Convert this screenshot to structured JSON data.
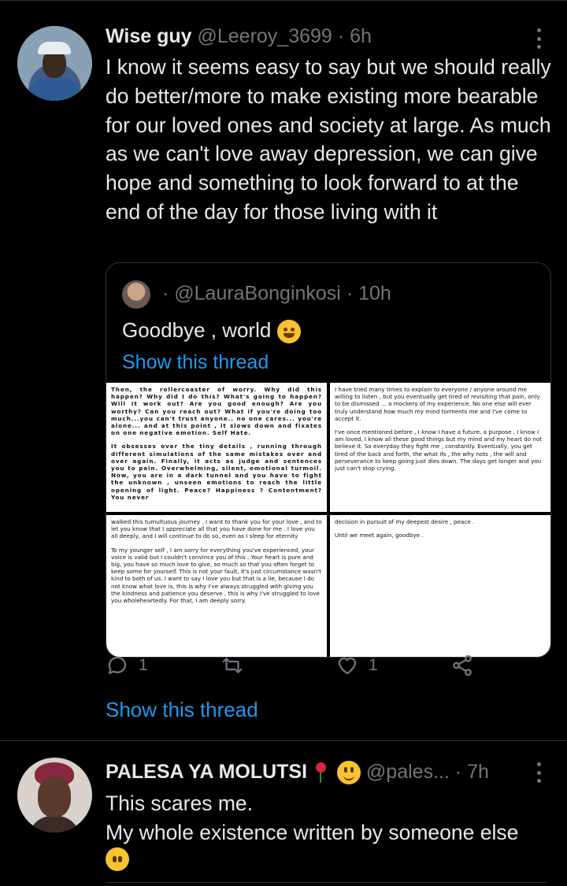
{
  "tweet1": {
    "display_name": "Wise guy",
    "handle": "@Leeroy_3699",
    "separator": "·",
    "time": "6h",
    "text": "I know it seems easy to say but we should really do better/more to make existing more bearable for our loved ones and society at large. As much as we can't love away depression, we can give hope and something to look forward to at the end of the day for those living with it",
    "quoted": {
      "dot": "·",
      "handle": "@LauraBonginkosi",
      "separator": "·",
      "time": "10h",
      "text": "Goodbye , world",
      "emoji": "hugging-face-emoji",
      "show_thread": "Show this thread",
      "images": {
        "img1": [
          "Then, the rollercoaster of worry. Why did this happen? Why did I do this? What's going to happen? Will it work out? Are you good enough? Are you worthy? Can you reach out? What if you're doing too much...you can't trust anyone.. no one cares... you're alone... and at this point , it slows down and fixates on one negative emotion. Self Hate.",
          "It obsesses over the tiny details , running through different simulations of the same mistakes over and over again. Finally, it acts as judge and sentences you to pain. Overwhelming, silent, emotional turmoil. Now, you are in a dark tunnel and you have to fight the unknown , unseen emotions to reach the little opening of light. Peace? Happiness ? Contentment? You never"
        ],
        "img2": [
          "I have tried many times to explain to everyone / anyone around me willing to listen , but you eventually get tired of revisiting that pain, only to be dismissed ... a mockery of my experience. No one else will ever truly understand how much my mind torments me and I've come to accept it.",
          "I've once mentioned before , I know I have a future, a purpose , I know I am loved, I know all these good things but my mind and my heart do not believe it. So everyday they fight me , constantly. Eventually, you get tired of the back and forth, the what ifs , the why nots , the will and perseverance to keep going just dies down. The days get longer and you just can't stop crying."
        ],
        "img3": [
          "walked this tumultuous journey . I want to thank you for your love , and to let you know that I appreciate all that you have done for me . I love you all deeply, and I will continue to do so, even as I sleep for eternity",
          "To my younger self , I am sorry for everything you've experienced, your voice is valid but I couldn't convince you of this . Your heart is pure and big, you have so much love to give, so much so that you often forget to keep some for yourself. This is not your fault, it's just circumstance wasn't kind to both of us. I want to say I love you but that is a lie, because I do not know what love is, this is why I've always struggled with giving you the kindness and patience you deserve , this is why I've struggled to love you wholeheartedly. For that, I am deeply sorry."
        ],
        "img4": [
          "decision in pursuit of my deepest desire , peace .",
          "Until we meet again, goodbye ."
        ]
      }
    },
    "actions": {
      "reply_count": "1",
      "retweet_count": "",
      "like_count": "1"
    },
    "show_thread": "Show this thread"
  },
  "tweet2": {
    "display_name": "PALESA YA MOLUTSI",
    "handle": "@pales...",
    "separator": "·",
    "time": "7h",
    "line1": "This scares me.",
    "line2": "My whole existence written by someone else",
    "emoji": "face-without-mouth-emoji"
  },
  "colors": {
    "background": "#000000",
    "text": "#e7e9ea",
    "secondary": "#71767b",
    "link": "#1d9bf0",
    "border": "#2f3336"
  }
}
